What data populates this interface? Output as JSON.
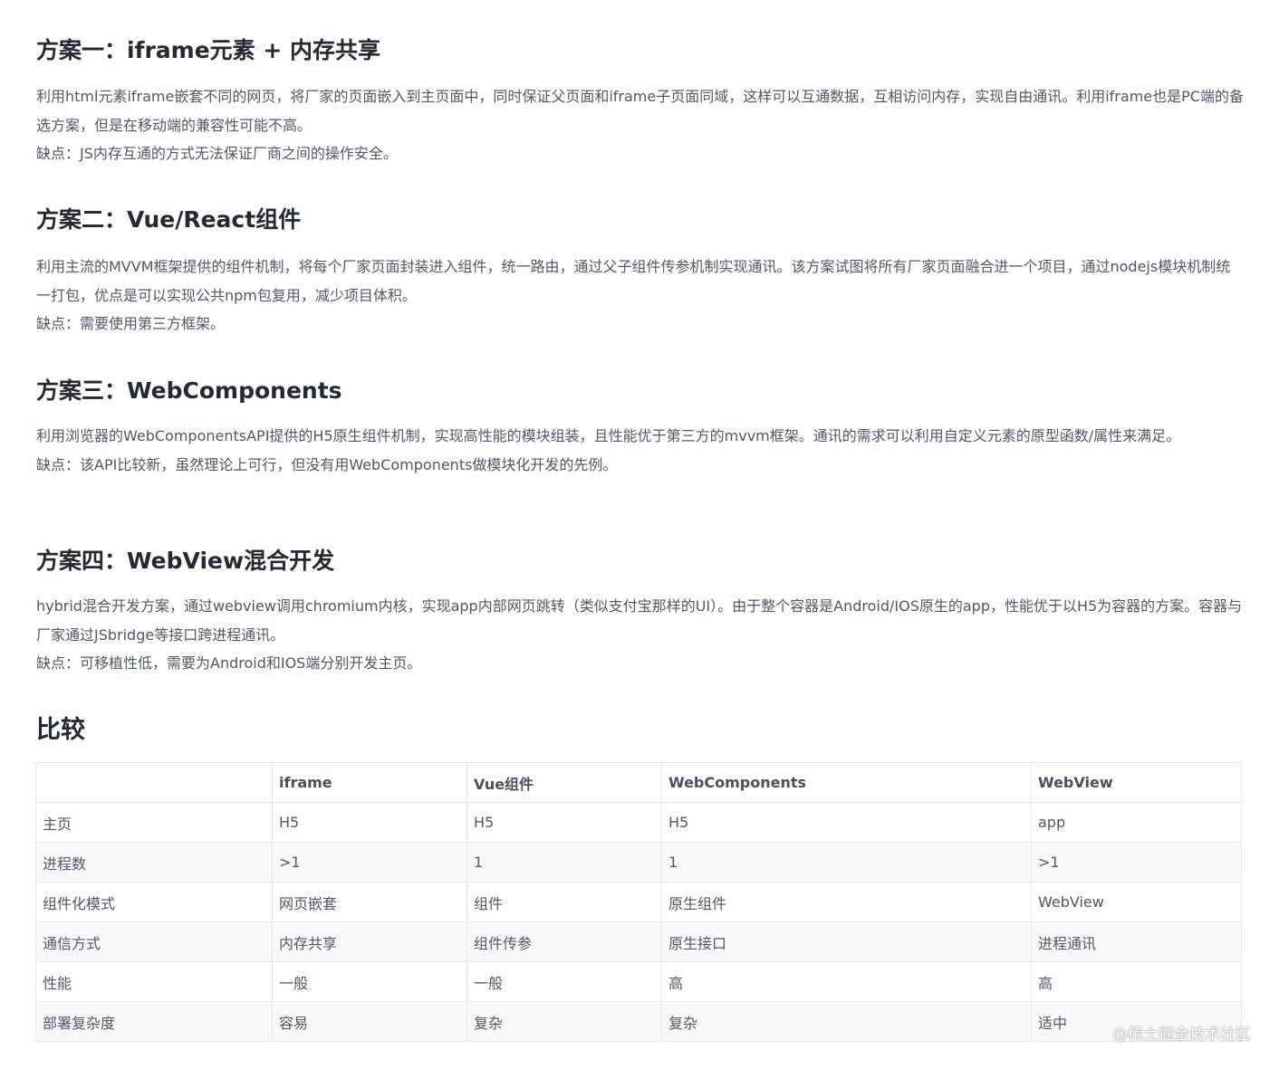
{
  "sections": [
    {
      "title": "方案一：iframe元素 + 内存共享",
      "body": "利用html元素iframe嵌套不同的网页，将厂家的页面嵌入到主页面中，同时保证父页面和iframe子页面同域，这样可以互通数据，互相访问内存，实现自由通讯。利用iframe也是PC端的备选方案，但是在移动端的兼容性可能不高。",
      "drawback": "缺点：JS内存互通的方式无法保证厂商之间的操作安全。"
    },
    {
      "title": "方案二：Vue/React组件",
      "body": "利用主流的MVVM框架提供的组件机制，将每个厂家页面封装进入组件，统一路由，通过父子组件传参机制实现通讯。该方案试图将所有厂家页面融合进一个项目，通过nodejs模块机制统一打包，优点是可以实现公共npm包复用，减少项目体积。",
      "drawback": "缺点：需要使用第三方框架。"
    },
    {
      "title": "方案三：WebComponents",
      "body": "利用浏览器的WebComponentsAPI提供的H5原生组件机制，实现高性能的模块组装，且性能优于第三方的mvvm框架。通讯的需求可以利用自定义元素的原型函数/属性来满足。",
      "drawback": "缺点：该API比较新，虽然理论上可行，但没有用WebComponents做模块化开发的先例。"
    },
    {
      "title": "方案四：WebView混合开发",
      "body": "hybrid混合开发方案，通过webview调用chromium内核，实现app内部网页跳转（类似支付宝那样的UI）。由于整个容器是Android/IOS原生的app，性能优于以H5为容器的方案。容器与厂家通过JSbridge等接口跨进程通讯。",
      "drawback": "缺点：可移植性低，需要为Android和IOS端分别开发主页。"
    }
  ],
  "comparison": {
    "title": "比较",
    "headers": [
      "",
      "iframe",
      "Vue组件",
      "WebComponents",
      "WebView"
    ],
    "rows": [
      [
        "主页",
        "H5",
        "H5",
        "H5",
        "app"
      ],
      [
        "进程数",
        ">1",
        "1",
        "1",
        ">1"
      ],
      [
        "组件化模式",
        "网页嵌套",
        "组件",
        "原生组件",
        "WebView"
      ],
      [
        "通信方式",
        "内存共享",
        "组件传参",
        "原生接口",
        "进程通讯"
      ],
      [
        "性能",
        "一般",
        "一般",
        "高",
        "高"
      ],
      [
        "部署复杂度",
        "容易",
        "复杂",
        "复杂",
        "适中"
      ]
    ]
  },
  "watermark": "@稀土掘金技术社区"
}
